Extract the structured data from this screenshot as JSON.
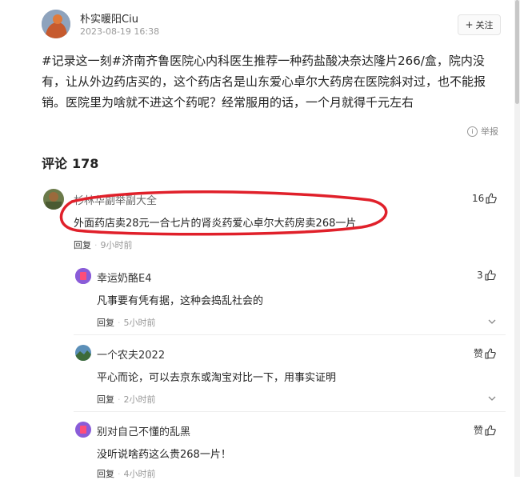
{
  "post": {
    "author": "朴实暖阳Ciu",
    "time": "2023-08-19 16:38",
    "follow_label": "关注",
    "content": "#记录这一刻#济南齐鲁医院心内科医生推荐一种药盐酸决奈达隆片266/盒，院内没有，让从外边药店买的，这个药店名是山东爱心卓尔大药房在医院斜对过，也不能报销。医院里为啥就不进这个药呢？经常服用的话，一个月就得千元左右",
    "report_label": "举报"
  },
  "comments": {
    "title": "评论",
    "count": "178",
    "top": {
      "user": "杉林华副举副大全",
      "likes": "16",
      "text": "外面药店卖28元一合七片的肾炎药爱心卓尔大药房卖268一片",
      "reply_label": "回复",
      "time": "9小时前"
    },
    "replies": [
      {
        "user": "幸运奶酪E4",
        "likes": "3",
        "text": "凡事要有凭有据，这种会捣乱社会的",
        "reply_label": "回复",
        "time": "5小时前"
      },
      {
        "user": "一个农夫2022",
        "likes": "赞",
        "text": "平心而论，可以去京东或淘宝对比一下，用事实证明",
        "reply_label": "回复",
        "time": "2小时前"
      },
      {
        "user": "别对自己不懂的乱黑",
        "likes": "赞",
        "text": "没听说啥药这么贵268一片！",
        "reply_label": "回复",
        "time": "4小时前"
      }
    ]
  },
  "colors": {
    "annotation_red": "#e0202a",
    "muted": "#999999"
  }
}
